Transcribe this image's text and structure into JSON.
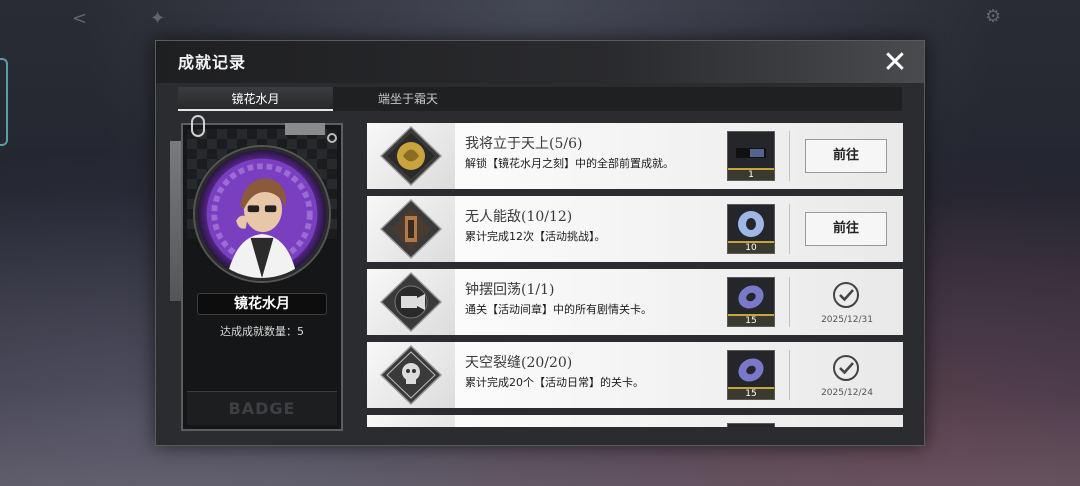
{
  "background": {
    "topbar_icons": [
      "share-icon",
      "settings-icon"
    ],
    "topbar_text": "",
    "top_right_icon": "gear-icon"
  },
  "modal": {
    "title": "成就记录",
    "close_icon": "✕",
    "tabs": [
      {
        "label": "镜花水月",
        "active": true
      },
      {
        "label": "端坐于霜天",
        "active": false
      }
    ]
  },
  "badge": {
    "character_name": "镜花水月",
    "count_label": "达成成就数量：5",
    "footer_text": "BADGE"
  },
  "achievements": [
    {
      "title": "我将立于天上(5/6)",
      "desc": "解锁【镜花水月之刻】中的全部前置成就。",
      "reward_qty": "1",
      "reward_icon": "image-reward-icon",
      "status": "goto",
      "button_label": "前往",
      "date": ""
    },
    {
      "title": "无人能敌(10/12)",
      "desc": "累计完成12次【活动挑战】。",
      "reward_qty": "10",
      "reward_icon": "ring-token-icon",
      "status": "goto",
      "button_label": "前往",
      "date": ""
    },
    {
      "title": "钟摆回荡(1/1)",
      "desc": "通关【活动间章】中的所有剧情关卡。",
      "reward_qty": "15",
      "reward_icon": "ring-token-icon",
      "status": "done",
      "button_label": "",
      "date": "2025/12/31"
    },
    {
      "title": "天空裂缝(20/20)",
      "desc": "累计完成20个【活动日常】的关卡。",
      "reward_qty": "15",
      "reward_icon": "ring-token-icon",
      "status": "done",
      "button_label": "",
      "date": "2025/12/24"
    }
  ],
  "colors": {
    "accent_gold": "#c9a33d",
    "panel_bg": "#2b2c2f",
    "row_bg": "#ffffff"
  }
}
